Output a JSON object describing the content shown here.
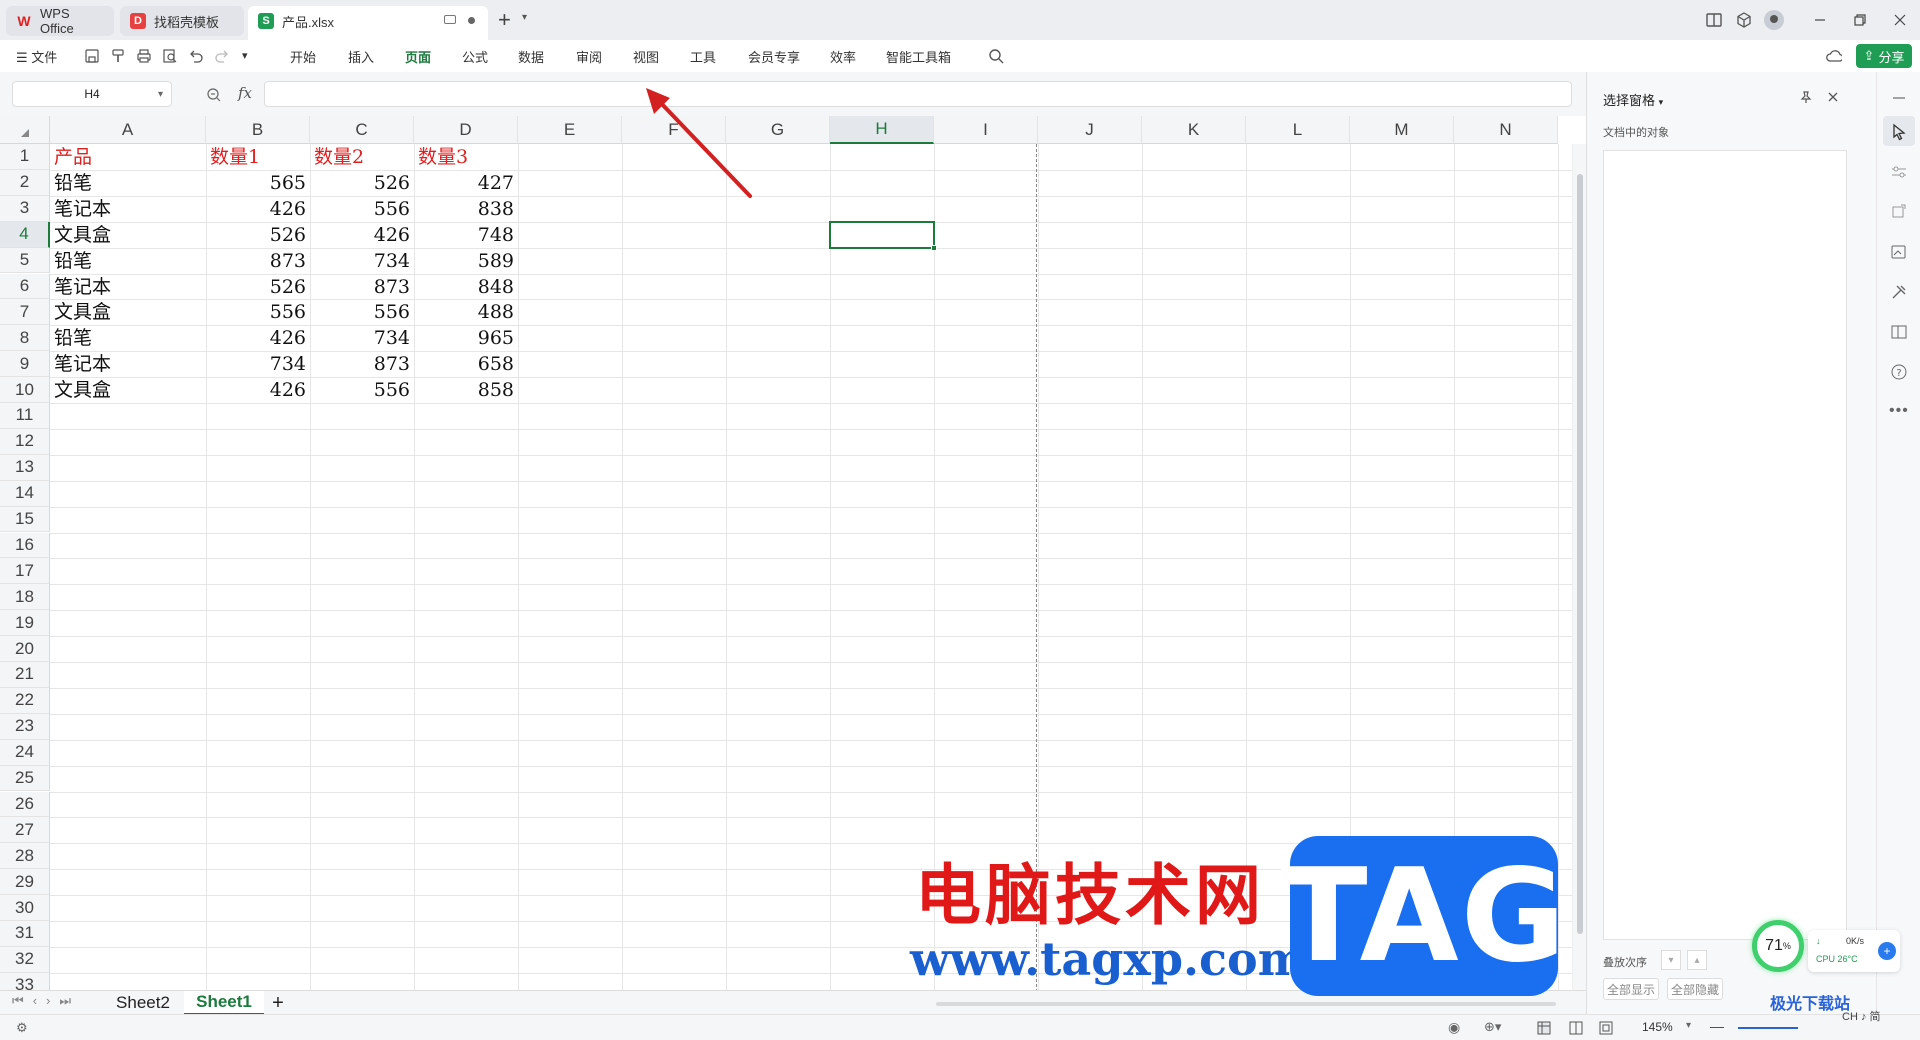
{
  "tabs": [
    {
      "label": "WPS Office",
      "icon": "wps-logo-icon"
    },
    {
      "label": "找稻壳模板",
      "icon": "docer-icon"
    },
    {
      "label": "产品.xlsx",
      "icon": "spreadsheet-icon"
    }
  ],
  "menu": {
    "file": "文件",
    "items": [
      "开始",
      "插入",
      "页面",
      "公式",
      "数据",
      "审阅",
      "视图",
      "工具",
      "会员专享",
      "效率",
      "智能工具箱"
    ],
    "active": "页面",
    "share": "分享"
  },
  "formula": {
    "name_box": "H4",
    "fx": "fx",
    "value": ""
  },
  "grid": {
    "columns": [
      "A",
      "B",
      "C",
      "D",
      "E",
      "F",
      "G",
      "H",
      "I",
      "J",
      "K",
      "L",
      "M",
      "N"
    ],
    "selected_column": "H",
    "rows": [
      "1",
      "2",
      "3",
      "4",
      "5",
      "6",
      "7",
      "8",
      "9",
      "10",
      "11",
      "12",
      "13",
      "14",
      "15",
      "16",
      "17",
      "18",
      "19",
      "20",
      "21",
      "22",
      "23",
      "24",
      "25",
      "26",
      "27",
      "28",
      "29",
      "30",
      "31",
      "32",
      "33"
    ],
    "selected_row": "4",
    "selected_cell": "H4",
    "header_row": [
      "产品",
      "数量1",
      "数量2",
      "数量3"
    ],
    "data": [
      [
        "铅笔",
        "565",
        "526",
        "427"
      ],
      [
        "笔记本",
        "426",
        "556",
        "838"
      ],
      [
        "文具盒",
        "526",
        "426",
        "748"
      ],
      [
        "铅笔",
        "873",
        "734",
        "589"
      ],
      [
        "笔记本",
        "526",
        "873",
        "848"
      ],
      [
        "文具盒",
        "556",
        "556",
        "488"
      ],
      [
        "铅笔",
        "426",
        "734",
        "965"
      ],
      [
        "笔记本",
        "734",
        "873",
        "658"
      ],
      [
        "文具盒",
        "426",
        "556",
        "858"
      ]
    ],
    "header_color": "#e02020"
  },
  "sheets": {
    "items": [
      "Sheet2",
      "Sheet1"
    ],
    "active": "Sheet1",
    "add": "+"
  },
  "panel": {
    "title": "选择窗格",
    "subtitle": "文档中的对象",
    "order_label": "叠放次序",
    "show_all": "全部显示",
    "hide_all": "全部隐藏"
  },
  "status": {
    "zoom": "145%"
  },
  "monitor": {
    "percent": "71",
    "percent_unit": "%",
    "net": "0K/s",
    "cpu": "CPU 26°C"
  },
  "watermark": {
    "cn": "电脑技术网",
    "url": "www.tagxp.com",
    "tag": "TAG",
    "corner": "极光下载站",
    "corner2": "CH ♪ 简"
  },
  "colors": {
    "accent": "#1d7a3d",
    "share": "#1f9d54",
    "arrow": "#d32020",
    "tag_bg": "#1a6ff0"
  }
}
